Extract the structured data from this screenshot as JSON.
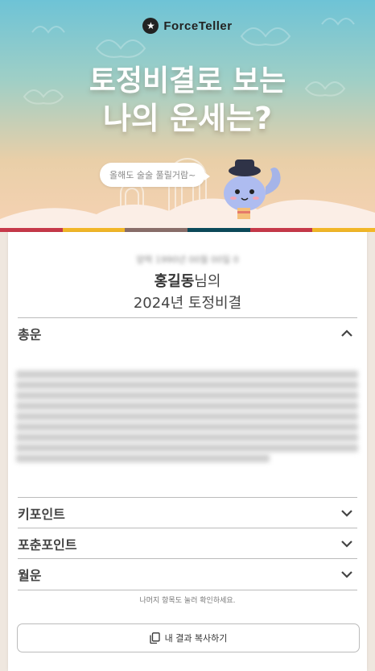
{
  "brand": {
    "name": "ForceTeller"
  },
  "hero": {
    "title_line1": "토정비결로 보는",
    "title_line2": "나의 운세는?",
    "speech": "올해도 술술 풀릴거람~"
  },
  "colors": {
    "strip": [
      "#c7394a",
      "#f2b728",
      "#8a6f6a",
      "#0c4a5a",
      "#c7394a",
      "#f2b728"
    ],
    "accent_text": "#444444"
  },
  "result": {
    "birth_info": "양력 1990년 00월 00일 0",
    "name": "홍길동",
    "name_suffix": "님의",
    "year_title": "2024년 토정비결"
  },
  "sections": [
    {
      "label": "총운",
      "expanded": true
    },
    {
      "label": "키포인트",
      "expanded": false
    },
    {
      "label": "포춘포인트",
      "expanded": false
    },
    {
      "label": "월운",
      "expanded": false
    }
  ],
  "hint": "나머지 항목도 눌러 확인하세요.",
  "copy_button": {
    "label": "내 결과 복사하기",
    "icon": "copy-icon"
  }
}
